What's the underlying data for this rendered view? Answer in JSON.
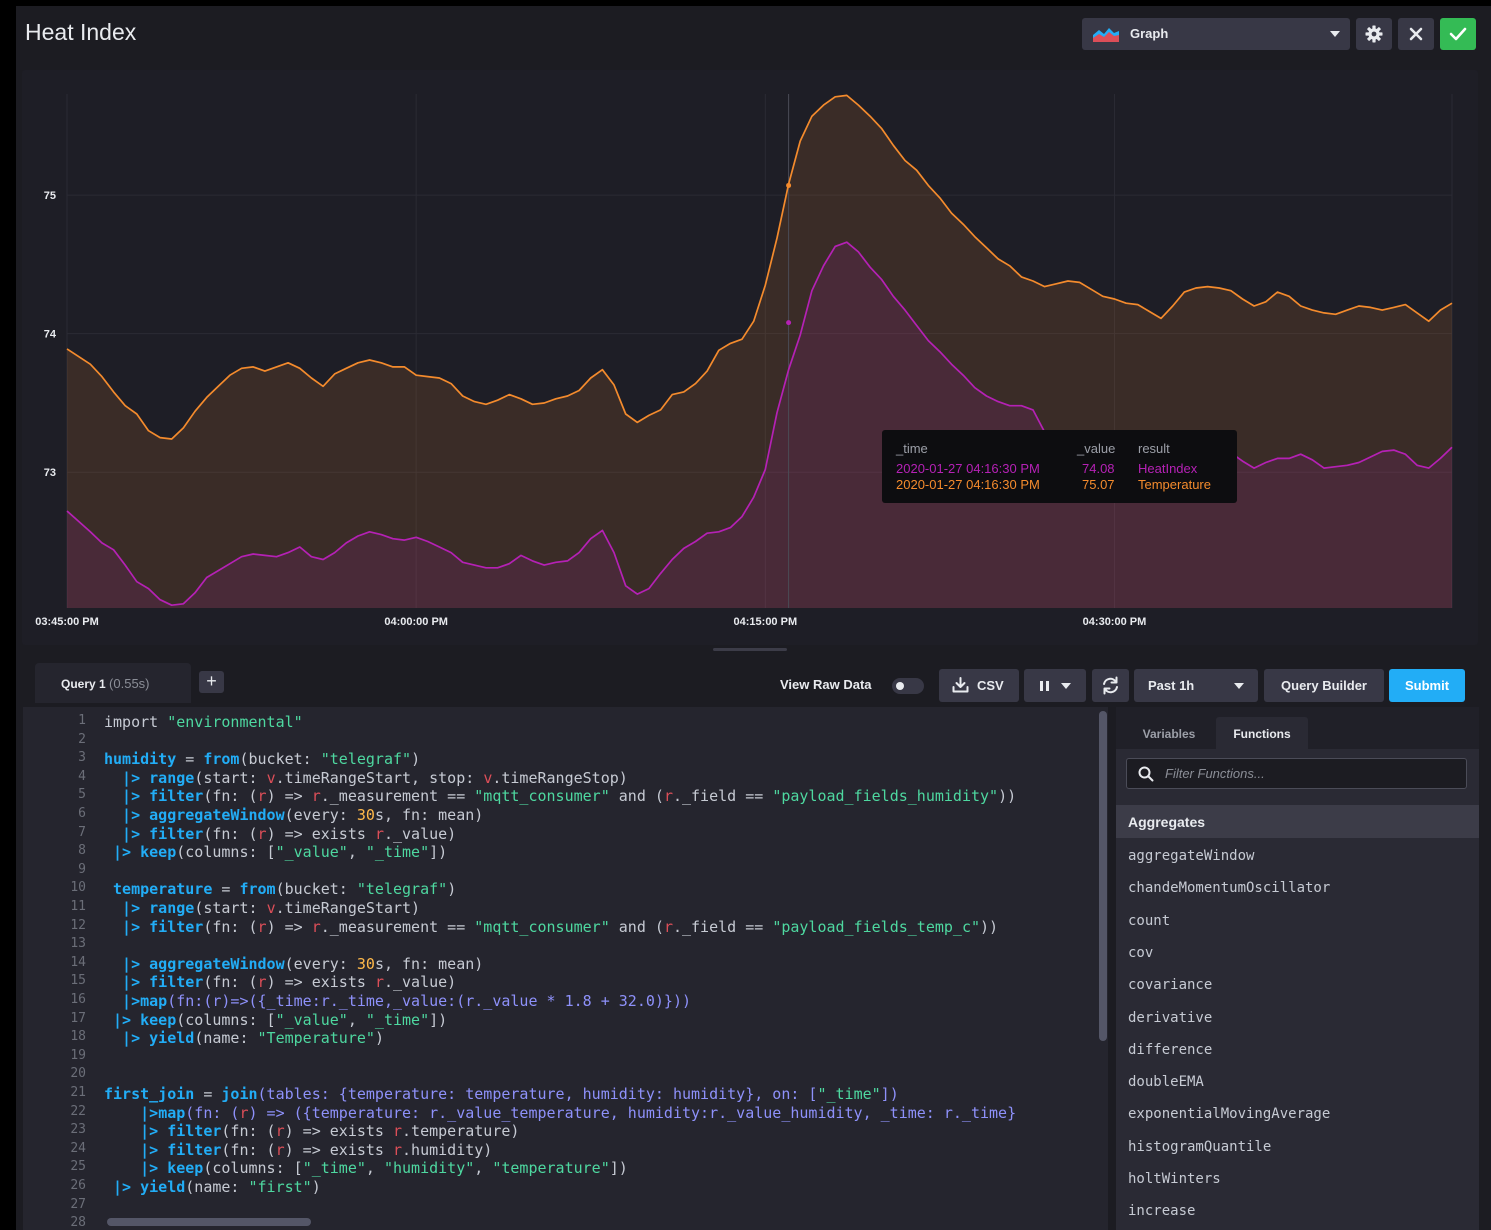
{
  "header": {
    "title": "Heat Index",
    "view_type": "Graph"
  },
  "chart_data": {
    "type": "line",
    "x_ticks": [
      "03:45:00 PM",
      "04:00:00 PM",
      "04:15:00 PM",
      "04:30:00 PM"
    ],
    "y_ticks": [
      "73",
      "74",
      "75"
    ],
    "ylim": [
      72.02,
      75.73
    ],
    "x_minutes": [
      0,
      1,
      1.5,
      2,
      2.5,
      3,
      3.5,
      4,
      4.5,
      5,
      5.5,
      6,
      6.5,
      7,
      7.5,
      8,
      8.5,
      9,
      9.5,
      10,
      10.5,
      11,
      11.5,
      12,
      12.5,
      13,
      13.5,
      14,
      14.5,
      15,
      15.5,
      16,
      16.5,
      17,
      17.5,
      18,
      18.5,
      19,
      19.5,
      20,
      20.5,
      21,
      21.5,
      22,
      22.5,
      23,
      23.5,
      24,
      24.5,
      25,
      25.5,
      26,
      26.5,
      27,
      27.5,
      28,
      28.5,
      29,
      29.5,
      30,
      30.5,
      31,
      31.5,
      32,
      32.5,
      33,
      33.5,
      34,
      34.5,
      35,
      35.5,
      36,
      36.5,
      37,
      37.5,
      38,
      38.5,
      39,
      39.5,
      40,
      40.5,
      41,
      41.5,
      42,
      42.5,
      43,
      43.5,
      44,
      44.5,
      45,
      45.5,
      46,
      46.5,
      47,
      47.5,
      48,
      48.5,
      49,
      49.5,
      50,
      50.5,
      51,
      51.5,
      52,
      52.5,
      53,
      53.5,
      54,
      54.5,
      55,
      55.5,
      56,
      56.5,
      57,
      57.5,
      58,
      58.5,
      59,
      59.5
    ],
    "series": [
      {
        "name": "Temperature",
        "color": "#f48b2d",
        "values": [
          73.89,
          73.78,
          73.69,
          73.58,
          73.48,
          73.42,
          73.3,
          73.25,
          73.24,
          73.32,
          73.44,
          73.54,
          73.62,
          73.7,
          73.75,
          73.76,
          73.73,
          73.76,
          73.79,
          73.75,
          73.68,
          73.62,
          73.71,
          73.75,
          73.79,
          73.81,
          73.79,
          73.76,
          73.76,
          73.7,
          73.69,
          73.68,
          73.64,
          73.55,
          73.51,
          73.49,
          73.52,
          73.56,
          73.53,
          73.49,
          73.5,
          73.53,
          73.55,
          73.59,
          73.68,
          73.74,
          73.63,
          73.42,
          73.36,
          73.41,
          73.45,
          73.56,
          73.58,
          73.64,
          73.73,
          73.88,
          73.93,
          73.96,
          74.09,
          74.35,
          74.69,
          75.08,
          75.39,
          75.57,
          75.65,
          75.71,
          75.72,
          75.65,
          75.57,
          75.48,
          75.36,
          75.25,
          75.18,
          75.07,
          74.98,
          74.87,
          74.79,
          74.7,
          74.62,
          74.54,
          74.49,
          74.41,
          74.38,
          74.34,
          74.36,
          74.38,
          74.37,
          74.32,
          74.27,
          74.25,
          74.22,
          74.21,
          74.16,
          74.11,
          74.2,
          74.3,
          74.33,
          74.34,
          74.33,
          74.31,
          74.25,
          74.2,
          74.23,
          74.3,
          74.27,
          74.2,
          74.17,
          74.15,
          74.14,
          74.17,
          74.2,
          74.19,
          74.17,
          74.19,
          74.21,
          74.15,
          74.09,
          74.17,
          74.22,
          74.25
        ]
      },
      {
        "name": "HeatIndex",
        "color": "#b521b5",
        "values": [
          72.72,
          72.57,
          72.49,
          72.44,
          72.33,
          72.21,
          72.16,
          72.08,
          72.04,
          72.05,
          72.13,
          72.24,
          72.29,
          72.34,
          72.39,
          72.41,
          72.4,
          72.39,
          72.42,
          72.46,
          72.39,
          72.37,
          72.42,
          72.49,
          72.54,
          72.57,
          72.55,
          72.52,
          72.51,
          72.53,
          72.5,
          72.46,
          72.42,
          72.35,
          72.33,
          72.31,
          72.31,
          72.34,
          72.4,
          72.36,
          72.33,
          72.35,
          72.36,
          72.42,
          72.52,
          72.58,
          72.42,
          72.18,
          72.12,
          72.16,
          72.27,
          72.37,
          72.45,
          72.5,
          72.56,
          72.57,
          72.6,
          72.68,
          72.82,
          73.02,
          73.43,
          73.74,
          73.99,
          74.31,
          74.49,
          74.63,
          74.66,
          74.59,
          74.48,
          74.39,
          74.27,
          74.17,
          74.06,
          73.95,
          73.87,
          73.78,
          73.7,
          73.61,
          73.55,
          73.51,
          73.48,
          73.48,
          73.45,
          73.29,
          73.24,
          73.17,
          73.2,
          73.23,
          73.27,
          73.28,
          73.25,
          73.21,
          73.14,
          73.12,
          73.2,
          73.26,
          73.29,
          73.25,
          73.17,
          73.14,
          73.08,
          73.03,
          73.07,
          73.1,
          73.1,
          73.13,
          73.09,
          73.03,
          73.04,
          73.05,
          73.07,
          73.11,
          73.15,
          73.16,
          73.13,
          73.05,
          73.03,
          73.1,
          73.18,
          73.22
        ]
      }
    ],
    "hover_minute": 31.0,
    "tooltip": {
      "headers": [
        "_time",
        "_value",
        "result"
      ],
      "rows": [
        {
          "time": "2020-01-27 04:16:30 PM",
          "value": "74.08",
          "result": "HeatIndex",
          "color": "#b521b5"
        },
        {
          "time": "2020-01-27 04:16:30 PM",
          "value": "75.07",
          "result": "Temperature",
          "color": "#f48b2d"
        }
      ]
    }
  },
  "toolbar": {
    "query_name": "Query 1",
    "query_time": "(0.55s)",
    "add_query": "+",
    "view_raw_data": "View Raw Data",
    "csv": "CSV",
    "time_range": "Past 1h",
    "query_builder": "Query Builder",
    "submit": "Submit"
  },
  "editor": {
    "line_numbers": [
      "1",
      "2",
      "3",
      "4",
      "5",
      "6",
      "7",
      "8",
      "9",
      "10",
      "11",
      "12",
      "13",
      "14",
      "15",
      "16",
      "17",
      "18",
      "19",
      "20",
      "21",
      "22",
      "23",
      "24",
      "25",
      "26",
      "27",
      "28"
    ],
    "lines": [
      [
        {
          "t": "import ",
          "c": ""
        },
        {
          "t": "\"environmental\"",
          "c": "str"
        }
      ],
      [],
      [
        {
          "t": "humidity",
          "c": "kw"
        },
        {
          "t": " = ",
          "c": ""
        },
        {
          "t": "from",
          "c": "kw"
        },
        {
          "t": "(bucket: ",
          "c": ""
        },
        {
          "t": "\"telegraf\"",
          "c": "str"
        },
        {
          "t": ")",
          "c": ""
        }
      ],
      [
        {
          "t": "  |> ",
          "c": "kw"
        },
        {
          "t": "range",
          "c": "kw"
        },
        {
          "t": "(start: ",
          "c": ""
        },
        {
          "t": "v",
          "c": "op"
        },
        {
          "t": ".timeRangeStart, stop: ",
          "c": ""
        },
        {
          "t": "v",
          "c": "op"
        },
        {
          "t": ".timeRangeStop)",
          "c": ""
        }
      ],
      [
        {
          "t": "  |> ",
          "c": "kw"
        },
        {
          "t": "filter",
          "c": "kw"
        },
        {
          "t": "(fn: (",
          "c": ""
        },
        {
          "t": "r",
          "c": "op"
        },
        {
          "t": ") => ",
          "c": ""
        },
        {
          "t": "r",
          "c": "op"
        },
        {
          "t": "._measurement == ",
          "c": ""
        },
        {
          "t": "\"mqtt_consumer\"",
          "c": "str"
        },
        {
          "t": " and (",
          "c": ""
        },
        {
          "t": "r",
          "c": "op"
        },
        {
          "t": "._field == ",
          "c": ""
        },
        {
          "t": "\"payload_fields_humidity\"",
          "c": "str"
        },
        {
          "t": "))",
          "c": ""
        }
      ],
      [
        {
          "t": "  |> ",
          "c": "kw"
        },
        {
          "t": "aggregateWindow",
          "c": "kw"
        },
        {
          "t": "(every: ",
          "c": ""
        },
        {
          "t": "30",
          "c": "num"
        },
        {
          "t": "s, fn: mean)",
          "c": ""
        }
      ],
      [
        {
          "t": "  |> ",
          "c": "kw"
        },
        {
          "t": "filter",
          "c": "kw"
        },
        {
          "t": "(fn: (",
          "c": ""
        },
        {
          "t": "r",
          "c": "op"
        },
        {
          "t": ") => exists ",
          "c": ""
        },
        {
          "t": "r",
          "c": "op"
        },
        {
          "t": "._value)",
          "c": ""
        }
      ],
      [
        {
          "t": " |> ",
          "c": "kw"
        },
        {
          "t": "keep",
          "c": "kw"
        },
        {
          "t": "(columns: [",
          "c": ""
        },
        {
          "t": "\"_value\"",
          "c": "str"
        },
        {
          "t": ", ",
          "c": ""
        },
        {
          "t": "\"_time\"",
          "c": "str"
        },
        {
          "t": "])",
          "c": ""
        }
      ],
      [],
      [
        {
          "t": " temperature",
          "c": "kw"
        },
        {
          "t": " = ",
          "c": ""
        },
        {
          "t": "from",
          "c": "kw"
        },
        {
          "t": "(bucket: ",
          "c": ""
        },
        {
          "t": "\"telegraf\"",
          "c": "str"
        },
        {
          "t": ")",
          "c": ""
        }
      ],
      [
        {
          "t": "  |> ",
          "c": "kw"
        },
        {
          "t": "range",
          "c": "kw"
        },
        {
          "t": "(start: ",
          "c": ""
        },
        {
          "t": "v",
          "c": "op"
        },
        {
          "t": ".timeRangeStart)",
          "c": ""
        }
      ],
      [
        {
          "t": "  |> ",
          "c": "kw"
        },
        {
          "t": "filter",
          "c": "kw"
        },
        {
          "t": "(fn: (",
          "c": ""
        },
        {
          "t": "r",
          "c": "op"
        },
        {
          "t": ") => ",
          "c": ""
        },
        {
          "t": "r",
          "c": "op"
        },
        {
          "t": "._measurement == ",
          "c": ""
        },
        {
          "t": "\"mqtt_consumer\"",
          "c": "str"
        },
        {
          "t": " and (",
          "c": ""
        },
        {
          "t": "r",
          "c": "op"
        },
        {
          "t": "._field == ",
          "c": ""
        },
        {
          "t": "\"payload_fields_temp_c\"",
          "c": "str"
        },
        {
          "t": "))",
          "c": ""
        }
      ],
      [],
      [
        {
          "t": "  |> ",
          "c": "kw"
        },
        {
          "t": "aggregateWindow",
          "c": "kw"
        },
        {
          "t": "(every: ",
          "c": ""
        },
        {
          "t": "30",
          "c": "num"
        },
        {
          "t": "s, fn: mean)",
          "c": ""
        }
      ],
      [
        {
          "t": "  |> ",
          "c": "kw"
        },
        {
          "t": "filter",
          "c": "kw"
        },
        {
          "t": "(fn: (",
          "c": ""
        },
        {
          "t": "r",
          "c": "op"
        },
        {
          "t": ") => exists ",
          "c": ""
        },
        {
          "t": "r",
          "c": "op"
        },
        {
          "t": "._value)",
          "c": ""
        }
      ],
      [
        {
          "t": "  |>",
          "c": "kw"
        },
        {
          "t": "map",
          "c": "kw"
        },
        {
          "t": "(fn:(r)=>({_time:r._time,_value:(r._value * 1.8 + 32.0)}))",
          "c": "fn"
        }
      ],
      [
        {
          "t": " |> ",
          "c": "kw"
        },
        {
          "t": "keep",
          "c": "kw"
        },
        {
          "t": "(columns: [",
          "c": ""
        },
        {
          "t": "\"_value\"",
          "c": "str"
        },
        {
          "t": ", ",
          "c": ""
        },
        {
          "t": "\"_time\"",
          "c": "str"
        },
        {
          "t": "])",
          "c": ""
        }
      ],
      [
        {
          "t": "  |> ",
          "c": "kw"
        },
        {
          "t": "yield",
          "c": "kw"
        },
        {
          "t": "(name: ",
          "c": ""
        },
        {
          "t": "\"Temperature\"",
          "c": "str"
        },
        {
          "t": ")",
          "c": ""
        }
      ],
      [],
      [],
      [
        {
          "t": "first_join",
          "c": "kw"
        },
        {
          "t": " = ",
          "c": ""
        },
        {
          "t": "join",
          "c": "kw"
        },
        {
          "t": "(tables: {temperature: temperature, humidity: humidity}, on: [",
          "c": "fn"
        },
        {
          "t": "\"_time\"",
          "c": "str"
        },
        {
          "t": "])",
          "c": "fn"
        }
      ],
      [
        {
          "t": "    |>",
          "c": "kw"
        },
        {
          "t": "map",
          "c": "kw"
        },
        {
          "t": "(fn: (",
          "c": "fn"
        },
        {
          "t": "r",
          "c": "op"
        },
        {
          "t": ") => ({temperature: r._value_temperature, humidity:r._value_humidity, _time: r._time}",
          "c": "fn"
        }
      ],
      [
        {
          "t": "    |> ",
          "c": "kw"
        },
        {
          "t": "filter",
          "c": "kw"
        },
        {
          "t": "(fn: (",
          "c": ""
        },
        {
          "t": "r",
          "c": "op"
        },
        {
          "t": ") => exists ",
          "c": ""
        },
        {
          "t": "r",
          "c": "op"
        },
        {
          "t": ".temperature)",
          "c": ""
        }
      ],
      [
        {
          "t": "    |> ",
          "c": "kw"
        },
        {
          "t": "filter",
          "c": "kw"
        },
        {
          "t": "(fn: (",
          "c": ""
        },
        {
          "t": "r",
          "c": "op"
        },
        {
          "t": ") => exists ",
          "c": ""
        },
        {
          "t": "r",
          "c": "op"
        },
        {
          "t": ".humidity)",
          "c": ""
        }
      ],
      [
        {
          "t": "    |> ",
          "c": "kw"
        },
        {
          "t": "keep",
          "c": "kw"
        },
        {
          "t": "(columns: [",
          "c": ""
        },
        {
          "t": "\"_time\"",
          "c": "str"
        },
        {
          "t": ", ",
          "c": ""
        },
        {
          "t": "\"humidity\"",
          "c": "str"
        },
        {
          "t": ", ",
          "c": ""
        },
        {
          "t": "\"temperature\"",
          "c": "str"
        },
        {
          "t": "])",
          "c": ""
        }
      ],
      [
        {
          "t": " |> ",
          "c": "kw"
        },
        {
          "t": "yield",
          "c": "kw"
        },
        {
          "t": "(name: ",
          "c": ""
        },
        {
          "t": "\"first\"",
          "c": "str"
        },
        {
          "t": ")",
          "c": ""
        }
      ],
      [],
      []
    ]
  },
  "side_panel": {
    "tab_variables": "Variables",
    "tab_functions": "Functions",
    "filter_placeholder": "Filter Functions...",
    "category": "Aggregates",
    "functions": [
      "aggregateWindow",
      "chandeMomentumOscillator",
      "count",
      "cov",
      "covariance",
      "derivative",
      "difference",
      "doubleEMA",
      "exponentialMovingAverage",
      "histogramQuantile",
      "holtWinters",
      "increase"
    ]
  }
}
